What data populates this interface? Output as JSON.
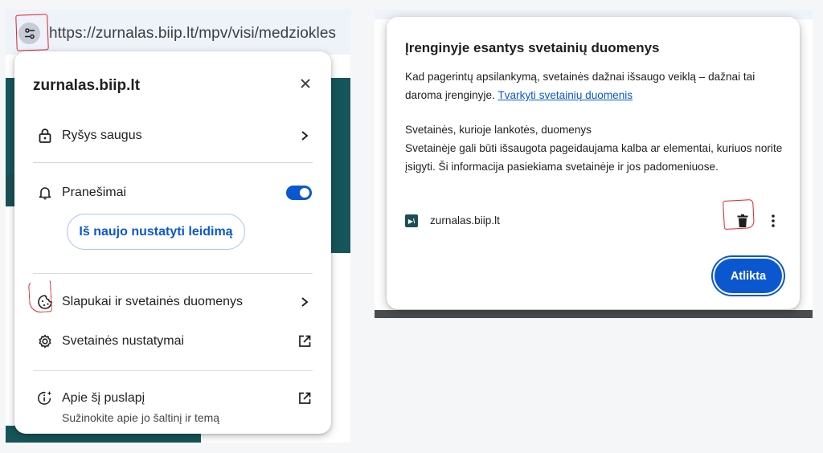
{
  "left_panel": {
    "url": "https://zurnalas.biip.lt/mpv/visi/medziokles",
    "site_info_icon": "tune-icon",
    "popup": {
      "domain": "zurnalas.biip.lt",
      "close_icon": "close-icon",
      "items": {
        "connection": {
          "label": "Ryšys saugus",
          "icon": "lock-icon",
          "trail_icon": "chevron-right-icon"
        },
        "notifications": {
          "label": "Pranešimai",
          "icon": "bell-icon",
          "toggle_on": true
        },
        "reset": {
          "label": "Iš naujo nustatyti leidimą"
        },
        "cookies": {
          "label": "Slapukai ir svetainės duomenys",
          "icon": "cookie-icon",
          "trail_icon": "chevron-right-icon"
        },
        "site_settings": {
          "label": "Svetainės nustatymai",
          "icon": "gear-icon",
          "trail_icon": "open-external-icon"
        },
        "about": {
          "label": "Apie šį puslapį",
          "sublabel": "Sužinokite apie jo šaltinį ir temą",
          "icon": "info-sparkle-icon",
          "trail_icon": "open-external-icon"
        }
      }
    }
  },
  "right_panel": {
    "dialog": {
      "title": "Įrenginyje esantys svetainių duomenys",
      "intro_text": "Kad pagerintų apsilankymą, svetainės dažnai išsaugo veiklą – dažnai tai daroma įrenginyje.",
      "manage_link": "Tvarkyti svetainių duomenis",
      "section_heading": "Svetainės, kurioje lankotės, duomenys",
      "section_text": "Svetainėje gali būti išsaugota pageidaujama kalba ar elementai, kuriuos norite įsigyti. Ši informacija pasiekiama svetainėje ir jos padomeniuose.",
      "site": {
        "name": "zurnalas.biip.lt",
        "favicon_text": "▶\\",
        "delete_icon": "trash-icon",
        "more_icon": "more-vert-icon"
      },
      "done_label": "Atlikta"
    }
  },
  "colors": {
    "accent": "#0b57d0",
    "teal": "#16555a",
    "annotation_red": "#e2232a"
  }
}
